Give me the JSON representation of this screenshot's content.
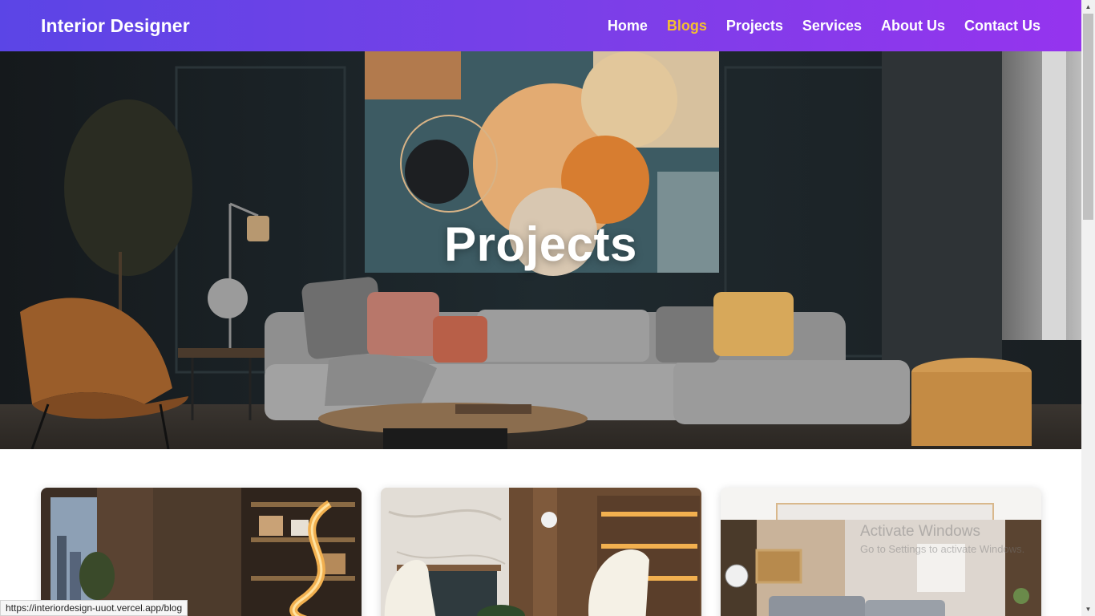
{
  "brand": "Interior Designer",
  "nav": [
    {
      "label": "Home",
      "active": false
    },
    {
      "label": "Blogs",
      "active": true
    },
    {
      "label": "Projects",
      "active": false
    },
    {
      "label": "Services",
      "active": false
    },
    {
      "label": "About Us",
      "active": false
    },
    {
      "label": "Contact Us",
      "active": false
    }
  ],
  "hero": {
    "title": "Projects"
  },
  "status_url": "https://interiordesign-uuot.vercel.app/blog",
  "watermark": {
    "line1": "Activate Windows",
    "line2": "Go to Settings to activate Windows."
  },
  "colors": {
    "nav_gradient_start": "#5b45e6",
    "nav_gradient_end": "#9534ee",
    "nav_active": "#f4c02f"
  }
}
